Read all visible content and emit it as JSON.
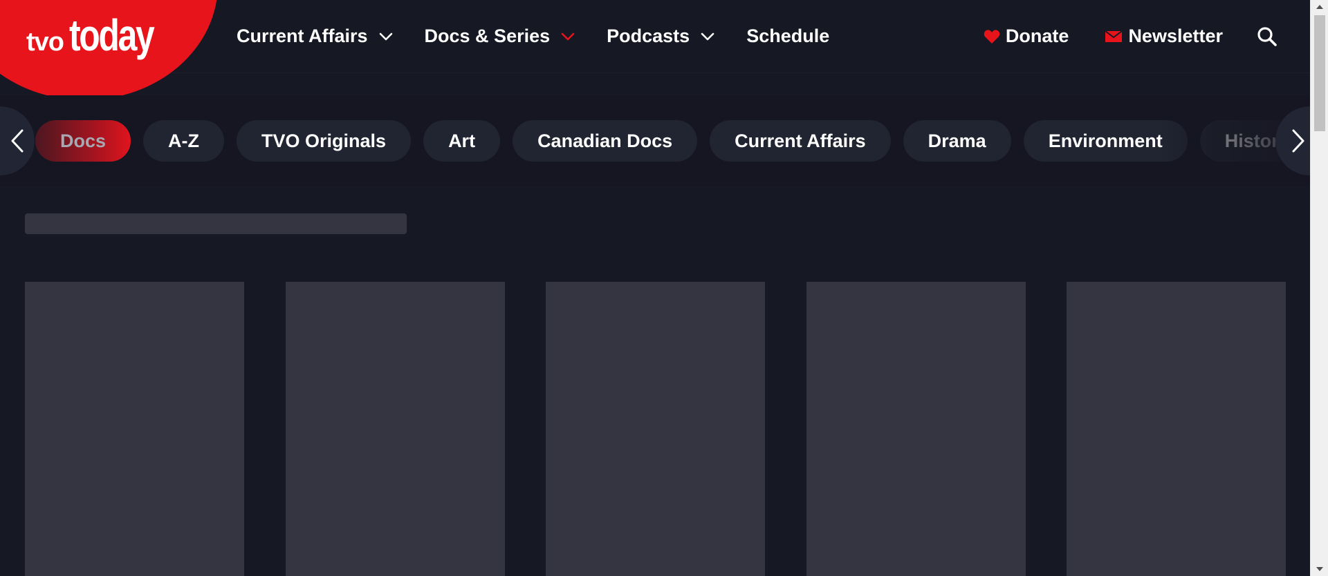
{
  "logo": {
    "tvo": "tvo",
    "today": "today",
    "brand_color": "#e8141c"
  },
  "nav": {
    "items": [
      {
        "label": "Current Affairs",
        "has_dropdown": true,
        "chevron_color": "#ffffff"
      },
      {
        "label": "Docs & Series",
        "has_dropdown": true,
        "chevron_color": "#e8141c"
      },
      {
        "label": "Podcasts",
        "has_dropdown": true,
        "chevron_color": "#ffffff"
      },
      {
        "label": "Schedule",
        "has_dropdown": false
      }
    ]
  },
  "utility": {
    "donate_label": "Donate",
    "donate_icon": "heart-icon",
    "newsletter_label": "Newsletter",
    "newsletter_icon": "envelope-icon",
    "search_icon": "search-icon",
    "icon_color": "#e8141c"
  },
  "categories": {
    "items": [
      "Docs",
      "A-Z",
      "TVO Originals",
      "Art",
      "Canadian Docs",
      "Current Affairs",
      "Drama",
      "Environment",
      "History"
    ],
    "active": "Docs",
    "prev_icon": "chevron-left-icon",
    "next_icon": "chevron-right-icon"
  },
  "colors": {
    "background": "#161823",
    "chip": "#212431",
    "skeleton": "#353541"
  }
}
